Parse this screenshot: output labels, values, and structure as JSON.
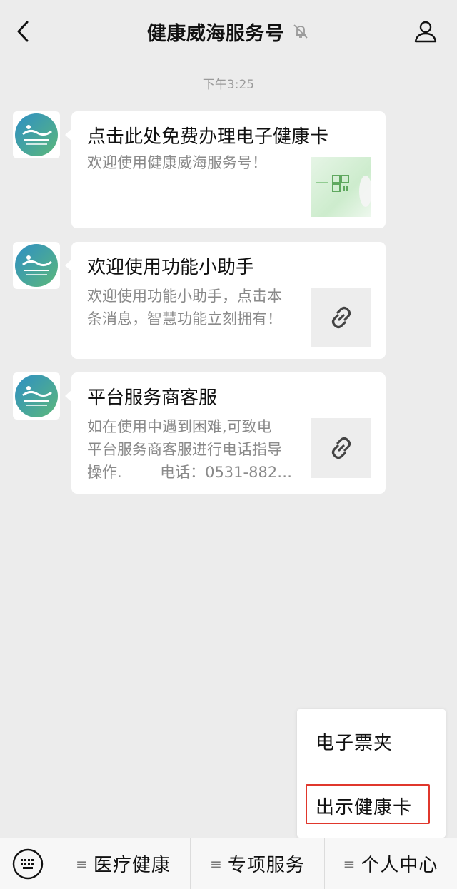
{
  "header": {
    "title": "健康威海服务号",
    "back_icon": "chevron-left-icon",
    "mute_icon": "bell-muted-icon",
    "profile_icon": "person-icon"
  },
  "chat": {
    "timestamp": "下午3:25",
    "messages": [
      {
        "title": "点击此处免费办理电子健康卡",
        "desc": "欢迎使用健康威海服务号！",
        "thumb_type": "health-card-image"
      },
      {
        "title": "欢迎使用功能小助手",
        "desc_lines": [
          "欢迎使用功能小助手，点击本",
          "条消息，智慧功能立刻拥有！"
        ],
        "thumb_type": "link-icon"
      },
      {
        "title": "平台服务商客服",
        "desc_lines": [
          "如在使用中遇到困难,可致电",
          "平台服务商客服进行电话指导",
          "操作.        电话：0531-882…"
        ],
        "thumb_type": "link-icon"
      }
    ]
  },
  "popup_menu": {
    "items": [
      "电子票夹",
      "出示健康卡"
    ],
    "highlighted_item": "出示健康卡"
  },
  "bottom_bar": {
    "keyboard_icon": "keyboard-icon",
    "menus": [
      {
        "label": "医疗健康"
      },
      {
        "label": "专项服务"
      },
      {
        "label": "个人中心"
      }
    ]
  },
  "colors": {
    "background": "#ececec",
    "card": "#ffffff",
    "highlight_border": "#e0372c"
  }
}
